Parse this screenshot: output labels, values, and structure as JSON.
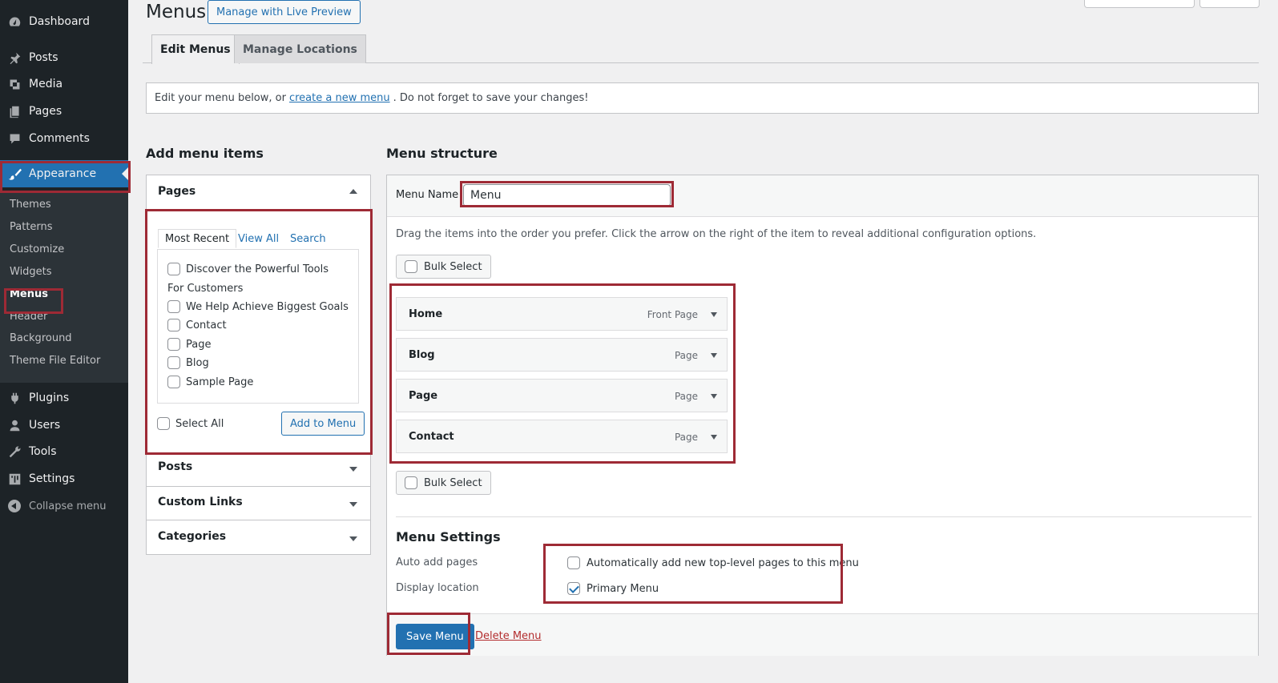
{
  "sidebar": {
    "items": [
      {
        "label": "Dashboard",
        "icon": "dashboard-icon"
      },
      {
        "label": "Posts",
        "icon": "pin-icon"
      },
      {
        "label": "Media",
        "icon": "media-icon"
      },
      {
        "label": "Pages",
        "icon": "pages-icon"
      },
      {
        "label": "Comments",
        "icon": "comment-icon"
      },
      {
        "label": "Appearance",
        "icon": "brush-icon"
      },
      {
        "label": "Plugins",
        "icon": "plugin-icon"
      },
      {
        "label": "Users",
        "icon": "user-icon"
      },
      {
        "label": "Tools",
        "icon": "wrench-icon"
      },
      {
        "label": "Settings",
        "icon": "settings-icon"
      }
    ],
    "submenu": [
      "Themes",
      "Patterns",
      "Customize",
      "Widgets",
      "Menus",
      "Header",
      "Background",
      "Theme File Editor"
    ],
    "collapse_label": "Collapse menu"
  },
  "header": {
    "title": "Menus",
    "live_preview_label": "Manage with Live Preview"
  },
  "tabs": [
    "Edit Menus",
    "Manage Locations"
  ],
  "notice": {
    "before": "Edit your menu below, or",
    "link": "create a new menu",
    "after": ". Do not forget to save your changes!"
  },
  "add_items": {
    "heading": "Add menu items",
    "pages_title": "Pages",
    "subtabs": [
      "Most Recent",
      "View All",
      "Search"
    ],
    "pages": [
      "Discover the Powerful Tools",
      "For  Customers",
      "We Help Achieve  Biggest Goals",
      "Contact",
      "Page",
      "Blog",
      "Sample Page"
    ],
    "select_all": "Select All",
    "add_button": "Add to Menu",
    "other_sections": [
      "Posts",
      "Custom Links",
      "Categories"
    ]
  },
  "structure": {
    "heading": "Menu structure",
    "menu_name_label": "Menu Name",
    "menu_name_value": "Menu",
    "drag_help": "Drag the items into the order you prefer. Click the arrow on the right of the item to reveal additional configuration options.",
    "bulk_select": "Bulk Select",
    "items": [
      {
        "title": "Home",
        "type": "Front Page"
      },
      {
        "title": "Blog",
        "type": "Page"
      },
      {
        "title": "Page",
        "type": "Page"
      },
      {
        "title": "Contact",
        "type": "Page"
      }
    ]
  },
  "settings": {
    "title": "Menu Settings",
    "auto_add_label": "Auto add pages",
    "auto_add_option": "Automatically add new top-level pages to this menu",
    "auto_add_checked": false,
    "display_location_label": "Display location",
    "display_location_option": "Primary Menu",
    "display_location_checked": true
  },
  "footer": {
    "save_label": "Save Menu",
    "delete_label": "Delete Menu"
  },
  "colors": {
    "accent": "#2271b1",
    "sidebar_bg": "#1d2327",
    "highlight": "#9e2a35",
    "delete": "#b32d2e"
  }
}
